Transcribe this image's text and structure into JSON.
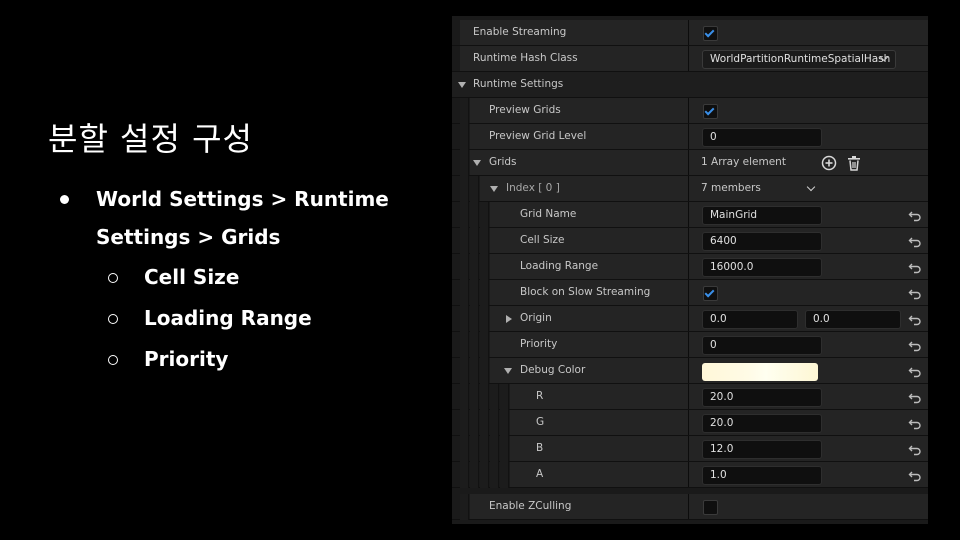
{
  "slide": {
    "title": "분할 설정 구성",
    "bullet_1_line_1": "World Settings > Runtime",
    "bullet_1_line_2": "Settings > Grids",
    "sub_bullets": [
      "Cell Size",
      "Loading Range",
      "Priority"
    ]
  },
  "panel": {
    "enable_streaming": {
      "label": "Enable Streaming",
      "checked": true
    },
    "runtime_hash_class": {
      "label": "Runtime Hash Class",
      "value": "WorldPartitionRuntimeSpatialHash"
    },
    "runtime_settings": {
      "label": "Runtime Settings"
    },
    "preview_grids": {
      "label": "Preview Grids",
      "checked": true
    },
    "preview_grid_level": {
      "label": "Preview Grid Level",
      "value": "0"
    },
    "grids": {
      "label": "Grids",
      "value": "1 Array element"
    },
    "index": {
      "label": "Index [ 0 ]",
      "value": "7 members"
    },
    "grid_name": {
      "label": "Grid Name",
      "value": "MainGrid"
    },
    "cell_size": {
      "label": "Cell Size",
      "value": "6400"
    },
    "loading_range": {
      "label": "Loading Range",
      "value": "16000.0"
    },
    "block_on_slow_streaming": {
      "label": "Block on Slow Streaming",
      "checked": true
    },
    "origin": {
      "label": "Origin",
      "x": "0.0",
      "y": "0.0"
    },
    "priority": {
      "label": "Priority",
      "value": "0"
    },
    "debug_color": {
      "label": "Debug Color",
      "color": "#fffbe3"
    },
    "r": {
      "label": "R",
      "value": "20.0"
    },
    "g": {
      "label": "G",
      "value": "20.0"
    },
    "b": {
      "label": "B",
      "value": "12.0"
    },
    "a": {
      "label": "A",
      "value": "1.0"
    },
    "enable_zculling": {
      "label": "Enable ZCulling",
      "checked": false
    }
  },
  "colors": {
    "accent_check": "#3a8fe8",
    "panel_bg": "#1a1a1a",
    "row_bg": "#242424"
  }
}
